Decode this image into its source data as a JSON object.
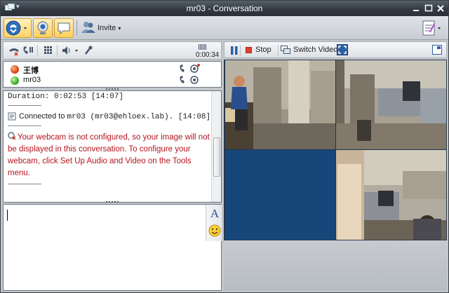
{
  "window": {
    "title": "mr03 - Conversation",
    "menu_glyph": "▾"
  },
  "toolbar": {
    "invite_label": "Invite",
    "invite_arrow": "▾"
  },
  "call_bar": {
    "duration": "0:00:34"
  },
  "participants": [
    {
      "name": "王博",
      "status_color": "#e0461b"
    },
    {
      "name": "mr03",
      "status_color": "#3dae2b"
    }
  ],
  "history": {
    "duration_line": "Duration: 0:02:53  [14:07]",
    "connected_prefix": "Connected to ",
    "connected_mono": "mr03 (mr03@ehloex.lab).",
    "connected_time": "  [14:08]",
    "webcam_warning": "Your webcam is not configured, so your image will not be displayed in this conversation. To configure your webcam, click Set Up Audio and Video on the Tools menu."
  },
  "compose": {
    "font_label": "A"
  },
  "video_bar": {
    "stop_label": "Stop",
    "switch_label": "Switch Video"
  },
  "colors": {
    "warning_red": "#b5141e",
    "video_blue": "#17477a",
    "accent_orange": "#ffd36a"
  }
}
